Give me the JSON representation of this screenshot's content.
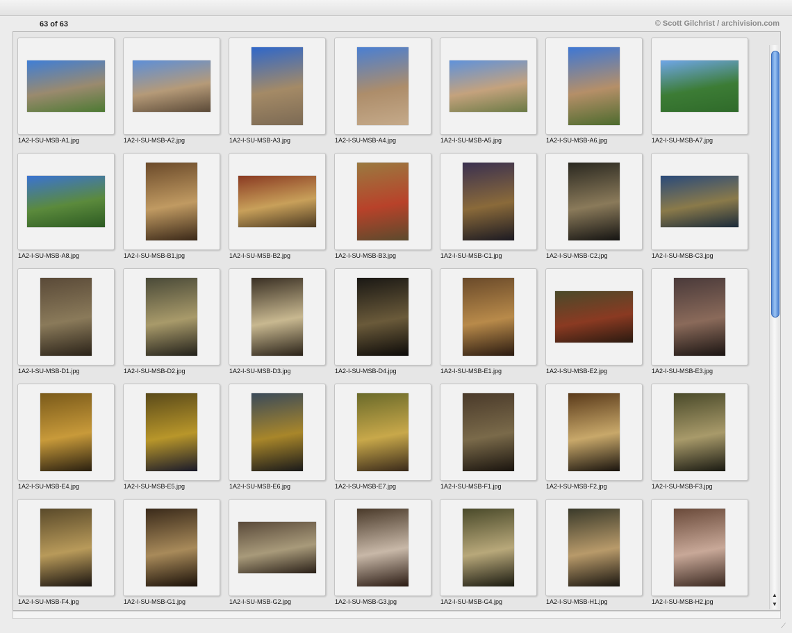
{
  "header": {
    "count_text": "63 of 63",
    "credit": "© Scott Gilchrist / archivision.com"
  },
  "thumbnails": [
    {
      "filename": "1A2-I-SU-MSB-A1.jpg",
      "orientation": "landscape",
      "colors": [
        "#3f7ed6",
        "#9a8a6e",
        "#4d7a33"
      ]
    },
    {
      "filename": "1A2-I-SU-MSB-A2.jpg",
      "orientation": "landscape",
      "colors": [
        "#5d8fd8",
        "#b59a78",
        "#5b4a38"
      ]
    },
    {
      "filename": "1A2-I-SU-MSB-A3.jpg",
      "orientation": "portrait",
      "colors": [
        "#2f67c9",
        "#a48a66",
        "#7c6a54"
      ]
    },
    {
      "filename": "1A2-I-SU-MSB-A4.jpg",
      "orientation": "portrait",
      "colors": [
        "#4a7fd2",
        "#ad8d6a",
        "#c5aa8a"
      ]
    },
    {
      "filename": "1A2-I-SU-MSB-A5.jpg",
      "orientation": "landscape",
      "colors": [
        "#5f92db",
        "#c4a27d",
        "#6a7a45"
      ]
    },
    {
      "filename": "1A2-I-SU-MSB-A6.jpg",
      "orientation": "portrait",
      "colors": [
        "#3e77d4",
        "#b58f68",
        "#4d6b2e"
      ]
    },
    {
      "filename": "1A2-I-SU-MSB-A7.jpg",
      "orientation": "landscape",
      "colors": [
        "#6fa6e8",
        "#3c7c35",
        "#2f6a2a"
      ]
    },
    {
      "filename": "1A2-I-SU-MSB-A8.jpg",
      "orientation": "landscape",
      "colors": [
        "#3a73d2",
        "#5b8a3c",
        "#2c5a22"
      ]
    },
    {
      "filename": "1A2-I-SU-MSB-B1.jpg",
      "orientation": "portrait",
      "colors": [
        "#6b4a2a",
        "#c09a62",
        "#3a2818"
      ]
    },
    {
      "filename": "1A2-I-SU-MSB-B2.jpg",
      "orientation": "landscape",
      "colors": [
        "#8a3a22",
        "#c8a05a",
        "#4c3a22"
      ]
    },
    {
      "filename": "1A2-I-SU-MSB-B3.jpg",
      "orientation": "portrait",
      "colors": [
        "#9a7a40",
        "#b8422a",
        "#5c4a2c"
      ]
    },
    {
      "filename": "1A2-I-SU-MSB-C1.jpg",
      "orientation": "portrait",
      "colors": [
        "#3a3050",
        "#8a6a3a",
        "#1c1a22"
      ]
    },
    {
      "filename": "1A2-I-SU-MSB-C2.jpg",
      "orientation": "portrait",
      "colors": [
        "#2a2820",
        "#8a7a5a",
        "#151412"
      ]
    },
    {
      "filename": "1A2-I-SU-MSB-C3.jpg",
      "orientation": "landscape",
      "colors": [
        "#2a4a7a",
        "#8a7a4a",
        "#1a2a3a"
      ]
    },
    {
      "filename": "1A2-I-SU-MSB-D1.jpg",
      "orientation": "portrait",
      "colors": [
        "#5a4a38",
        "#8a7a5a",
        "#2a2218"
      ]
    },
    {
      "filename": "1A2-I-SU-MSB-D2.jpg",
      "orientation": "portrait",
      "colors": [
        "#4a4a38",
        "#a89a6a",
        "#22201a"
      ]
    },
    {
      "filename": "1A2-I-SU-MSB-D3.jpg",
      "orientation": "portrait",
      "colors": [
        "#3a3024",
        "#c8b890",
        "#2a2218"
      ]
    },
    {
      "filename": "1A2-I-SU-MSB-D4.jpg",
      "orientation": "portrait",
      "colors": [
        "#1a1814",
        "#6a5a3a",
        "#0c0a08"
      ]
    },
    {
      "filename": "1A2-I-SU-MSB-E1.jpg",
      "orientation": "portrait",
      "colors": [
        "#6a4a2a",
        "#b88a4a",
        "#2a1a10"
      ]
    },
    {
      "filename": "1A2-I-SU-MSB-E2.jpg",
      "orientation": "landscape",
      "colors": [
        "#4a4a2a",
        "#8a3a22",
        "#2a1a10"
      ]
    },
    {
      "filename": "1A2-I-SU-MSB-E3.jpg",
      "orientation": "portrait",
      "colors": [
        "#4a3a3a",
        "#8a6a5a",
        "#1a1412"
      ]
    },
    {
      "filename": "1A2-I-SU-MSB-E4.jpg",
      "orientation": "portrait",
      "colors": [
        "#7a5a1a",
        "#c89a3a",
        "#2a2010"
      ]
    },
    {
      "filename": "1A2-I-SU-MSB-E5.jpg",
      "orientation": "portrait",
      "colors": [
        "#5a4a1a",
        "#b8962a",
        "#1a1a2a"
      ]
    },
    {
      "filename": "1A2-I-SU-MSB-E6.jpg",
      "orientation": "portrait",
      "colors": [
        "#3a4a5a",
        "#a8862a",
        "#1a1a1a"
      ]
    },
    {
      "filename": "1A2-I-SU-MSB-E7.jpg",
      "orientation": "portrait",
      "colors": [
        "#6a6a2a",
        "#c8a84a",
        "#3a2a1a"
      ]
    },
    {
      "filename": "1A2-I-SU-MSB-F1.jpg",
      "orientation": "portrait",
      "colors": [
        "#4a3a2a",
        "#7a6a4a",
        "#1a140e"
      ]
    },
    {
      "filename": "1A2-I-SU-MSB-F2.jpg",
      "orientation": "portrait",
      "colors": [
        "#5a3a1a",
        "#c8a86a",
        "#1a140e"
      ]
    },
    {
      "filename": "1A2-I-SU-MSB-F3.jpg",
      "orientation": "portrait",
      "colors": [
        "#4a4a2a",
        "#a89a6a",
        "#1a1a12"
      ]
    },
    {
      "filename": "1A2-I-SU-MSB-F4.jpg",
      "orientation": "portrait",
      "colors": [
        "#5a4a2a",
        "#b89a5a",
        "#1a1410"
      ]
    },
    {
      "filename": "1A2-I-SU-MSB-G1.jpg",
      "orientation": "portrait",
      "colors": [
        "#3a2a1a",
        "#a88a5a",
        "#1a1008"
      ]
    },
    {
      "filename": "1A2-I-SU-MSB-G2.jpg",
      "orientation": "landscape",
      "colors": [
        "#5a4a3a",
        "#a89a7a",
        "#2a2018"
      ]
    },
    {
      "filename": "1A2-I-SU-MSB-G3.jpg",
      "orientation": "portrait",
      "colors": [
        "#4a3a2a",
        "#c8b8a8",
        "#2a1a12"
      ]
    },
    {
      "filename": "1A2-I-SU-MSB-G4.jpg",
      "orientation": "portrait",
      "colors": [
        "#4a4a2a",
        "#b8a87a",
        "#1a1a10"
      ]
    },
    {
      "filename": "1A2-I-SU-MSB-H1.jpg",
      "orientation": "portrait",
      "colors": [
        "#3a3a2a",
        "#b89a6a",
        "#1a1610"
      ]
    },
    {
      "filename": "1A2-I-SU-MSB-H2.jpg",
      "orientation": "portrait",
      "colors": [
        "#6a4a3a",
        "#c8a898",
        "#3a2820"
      ]
    }
  ]
}
